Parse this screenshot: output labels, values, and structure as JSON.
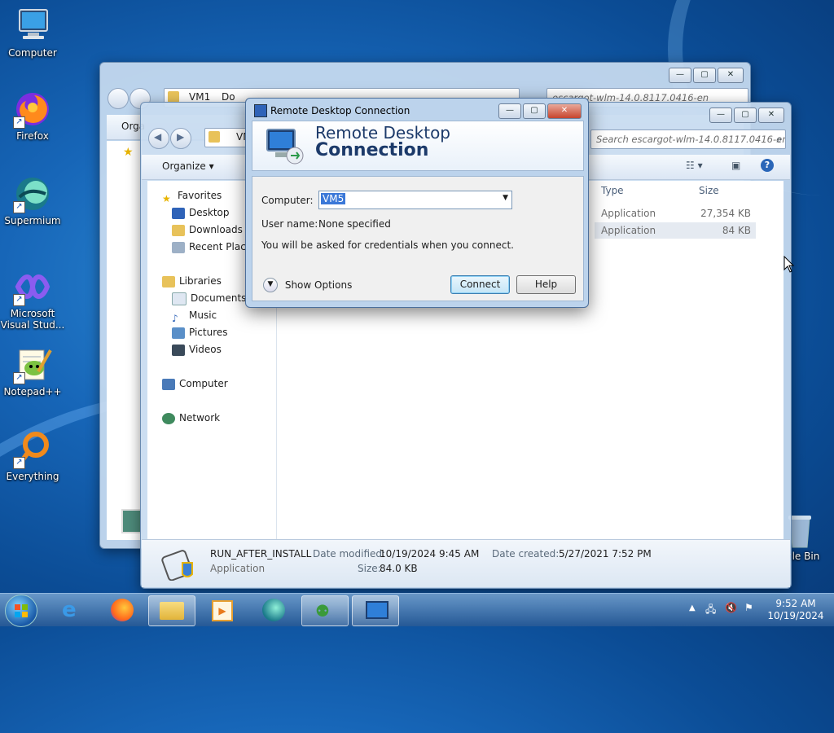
{
  "desktop_icons": [
    {
      "label": "Computer"
    },
    {
      "label": "Firefox"
    },
    {
      "label": "Supermium"
    },
    {
      "label": "Microsoft Visual Stud..."
    },
    {
      "label": "Notepad++"
    },
    {
      "label": "Everything"
    },
    {
      "label": "cle Bin"
    }
  ],
  "back_window": {
    "breadcrumb": [
      "VM1",
      "Do"
    ],
    "search_placeholder": "escargot-wlm-14.0.8117.0416-en",
    "organize_label": "Orga"
  },
  "explorer": {
    "breadcrumb_root": "VM",
    "search_placeholder": "Search escargot-wlm-14.0.8117.0416-en",
    "organize_label": "Organize",
    "nav": {
      "favorites": "Favorites",
      "desktop": "Desktop",
      "downloads": "Downloads",
      "recent_places": "Recent Places",
      "libraries": "Libraries",
      "documents": "Documents",
      "music": "Music",
      "pictures": "Pictures",
      "videos": "Videos",
      "computer": "Computer",
      "network": "Network"
    },
    "columns": {
      "type": "Type",
      "size": "Size"
    },
    "files": [
      {
        "type": "Application",
        "size": "27,354 KB"
      },
      {
        "type": "Application",
        "size": "84 KB"
      }
    ],
    "details": {
      "name": "RUN_AFTER_INSTALL",
      "kind": "Application",
      "modified_label": "Date modified:",
      "modified_value": "10/19/2024 9:45 AM",
      "created_label": "Date created:",
      "created_value": "5/27/2021 7:52 PM",
      "size_label": "Size:",
      "size_value": "84.0 KB"
    }
  },
  "rdc": {
    "window_title": "Remote Desktop Connection",
    "banner_line1": "Remote Desktop",
    "banner_line2": "Connection",
    "computer_label": "Computer:",
    "computer_value": "VM5",
    "username_label": "User name:",
    "username_value": "None specified",
    "credentials_note": "You will be asked for credentials when you connect.",
    "show_options": "Show Options",
    "connect_button": "Connect",
    "help_button": "Help"
  },
  "taskbar": {
    "time": "9:52 AM",
    "date": "10/19/2024"
  }
}
